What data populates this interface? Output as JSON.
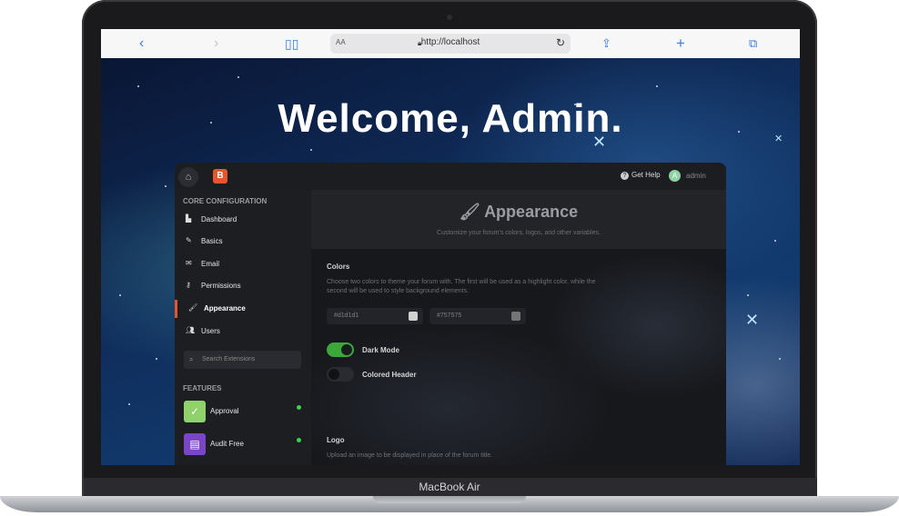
{
  "browser": {
    "back_icon": "back-chevron-icon",
    "forward_icon": "forward-chevron-icon",
    "bookmarks_icon": "book-icon",
    "text_size": "AA",
    "url": "http://localhost",
    "reload_icon": "reload-icon",
    "share_icon": "share-icon",
    "new_tab_icon": "plus-icon",
    "tabs_icon": "tabs-icon"
  },
  "page": {
    "welcome": "Welcome, Admin."
  },
  "topbar": {
    "help_label": "Get Help",
    "user_initial": "A",
    "username": "admin"
  },
  "sidebar": {
    "core_heading": "CORE CONFIGURATION",
    "items": [
      {
        "label": "Dashboard",
        "icon": "chart-icon"
      },
      {
        "label": "Basics",
        "icon": "pencil-icon"
      },
      {
        "label": "Email",
        "icon": "envelope-icon"
      },
      {
        "label": "Permissions",
        "icon": "key-icon"
      },
      {
        "label": "Appearance",
        "icon": "paintbrush-icon"
      },
      {
        "label": "Users",
        "icon": "users-icon"
      }
    ],
    "search_placeholder": "Search Extensions",
    "features_heading": "FEATURES",
    "features": [
      {
        "label": "Approval",
        "color": "#8fd26b",
        "icon": "check-icon"
      },
      {
        "label": "Audit Free",
        "color": "#7a46c7",
        "icon": "book-icon"
      }
    ]
  },
  "content": {
    "title": "Appearance",
    "subtitle": "Customize your forum's colors, logos, and other variables.",
    "colors_heading": "Colors",
    "colors_desc": "Choose two colors to theme your forum with. The first will be used as a highlight color, while the second will be used to style background elements.",
    "primary_color": "#d1d1d1",
    "secondary_color": "#757575",
    "dark_mode_label": "Dark Mode",
    "dark_mode_on": true,
    "colored_header_label": "Colored Header",
    "colored_header_on": false,
    "logo_heading": "Logo",
    "logo_desc": "Upload an image to be displayed in place of the forum title."
  },
  "device": {
    "label": "MacBook Air"
  },
  "colors": {
    "accent": "#e8552d",
    "toggle_on": "#3aa83a",
    "status_dot": "#3ccf4e"
  }
}
